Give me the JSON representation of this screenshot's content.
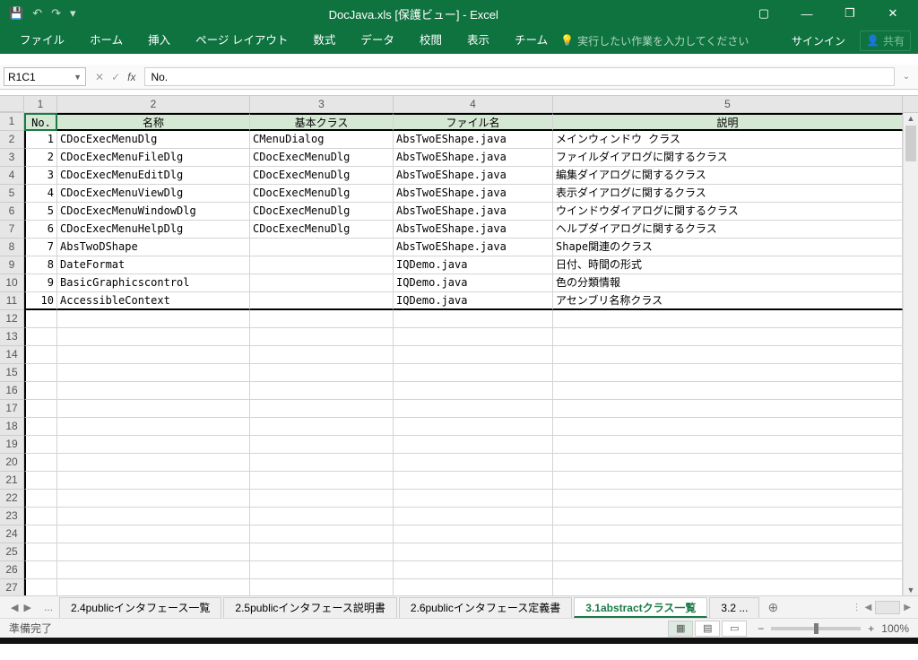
{
  "title_bar": {
    "doc_title": "DocJava.xls  [保護ビュー] - Excel",
    "save_icon": "💾",
    "undo": "↶",
    "redo": "↷",
    "customize": "▾",
    "ribbon_toggle": "▢",
    "minimize": "—",
    "maximize": "❐",
    "close": "✕"
  },
  "ribbon": {
    "tabs": [
      "ファイル",
      "ホーム",
      "挿入",
      "ページ レイアウト",
      "数式",
      "データ",
      "校閲",
      "表示",
      "チーム"
    ],
    "search_placeholder": "実行したい作業を入力してください",
    "signin": "サインイン",
    "share": "共有"
  },
  "fx": {
    "namebox": "R1C1",
    "formula": "No."
  },
  "col_headers": [
    "1",
    "2",
    "3",
    "4",
    "5"
  ],
  "row_headers": [
    "1",
    "2",
    "3",
    "4",
    "5",
    "6",
    "7",
    "8",
    "9",
    "10",
    "11",
    "12",
    "13",
    "14",
    "15",
    "16",
    "17",
    "18",
    "19",
    "20",
    "21",
    "22",
    "23",
    "24",
    "25",
    "26",
    "27"
  ],
  "header_row": [
    "No.",
    "名称",
    "基本クラス",
    "ファイル名",
    "説明"
  ],
  "data_rows": [
    [
      "1",
      "CDocExecMenuDlg",
      "CMenuDialog",
      "AbsTwoEShape.java",
      "メインウィンドウ クラス"
    ],
    [
      "2",
      "CDocExecMenuFileDlg",
      "CDocExecMenuDlg",
      "AbsTwoEShape.java",
      "ファイルダイアログに関するクラス"
    ],
    [
      "3",
      "CDocExecMenuEditDlg",
      "CDocExecMenuDlg",
      "AbsTwoEShape.java",
      "編集ダイアログに関するクラス"
    ],
    [
      "4",
      "CDocExecMenuViewDlg",
      "CDocExecMenuDlg",
      "AbsTwoEShape.java",
      "表示ダイアログに関するクラス"
    ],
    [
      "5",
      "CDocExecMenuWindowDlg",
      "CDocExecMenuDlg",
      "AbsTwoEShape.java",
      "ウインドウダイアログに関するクラス"
    ],
    [
      "6",
      "CDocExecMenuHelpDlg",
      "CDocExecMenuDlg",
      "AbsTwoEShape.java",
      "ヘルプダイアログに関するクラス"
    ],
    [
      "7",
      "AbsTwoDShape",
      "",
      "AbsTwoEShape.java",
      "Shape関連のクラス"
    ],
    [
      "8",
      "DateFormat",
      "",
      "IQDemo.java",
      "日付、時間の形式"
    ],
    [
      "9",
      "BasicGraphicscontrol",
      "",
      "IQDemo.java",
      "色の分類情報"
    ],
    [
      "10",
      "AccessibleContext",
      "",
      "IQDemo.java",
      "アセンブリ名称クラス"
    ]
  ],
  "sheet_tabs": {
    "items": [
      "2.4publicインタフェース一覧",
      "2.5publicインタフェース説明書",
      "2.6publicインタフェース定義書",
      "3.1abstractクラス一覧",
      "3.2 ..."
    ],
    "active_index": 3
  },
  "status": {
    "ready": "準備完了",
    "zoom": "100%"
  }
}
